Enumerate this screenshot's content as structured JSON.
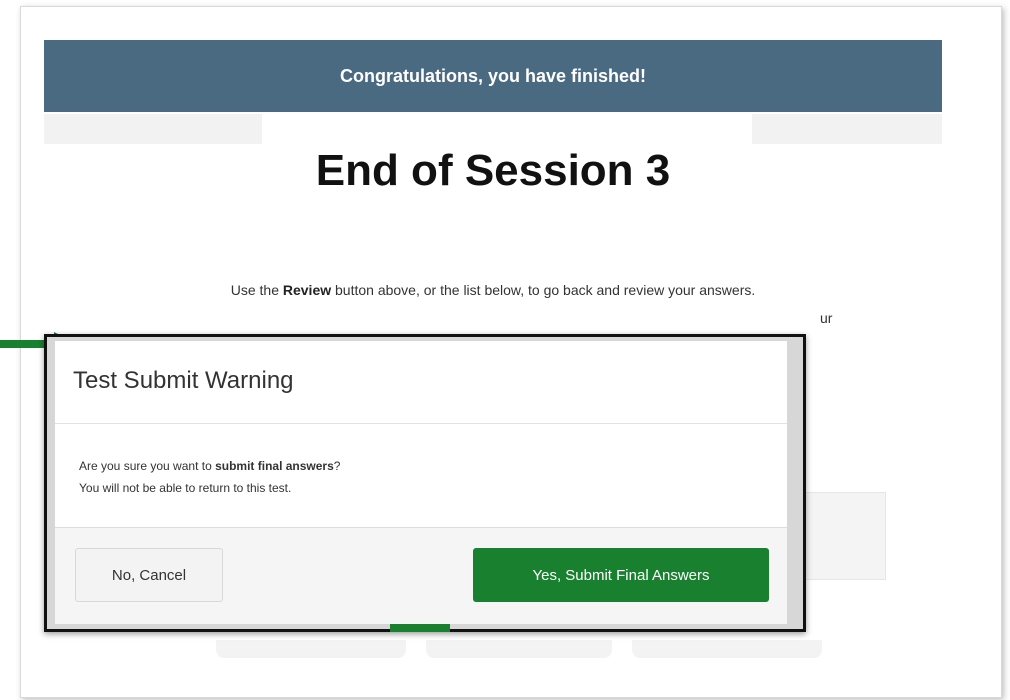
{
  "banner": {
    "text": "Congratulations, you have finished!"
  },
  "session": {
    "title": "End of Session 3"
  },
  "instructions": {
    "prefix": "Use the ",
    "bold": "Review",
    "suffix": " button above, or the list below, to go back and review your answers.",
    "cut_line": "ur"
  },
  "dialog": {
    "title": "Test Submit Warning",
    "body_line1_prefix": "Are you sure you want to ",
    "body_line1_bold": "submit final answers",
    "body_line1_suffix": "?",
    "body_line2": "You will not be able to return to this test.",
    "cancel_label": "No, Cancel",
    "submit_label": "Yes, Submit Final Answers"
  },
  "colors": {
    "banner_bg": "#4a6a82",
    "submit_bg": "#19802f",
    "arrow": "#19802f"
  }
}
